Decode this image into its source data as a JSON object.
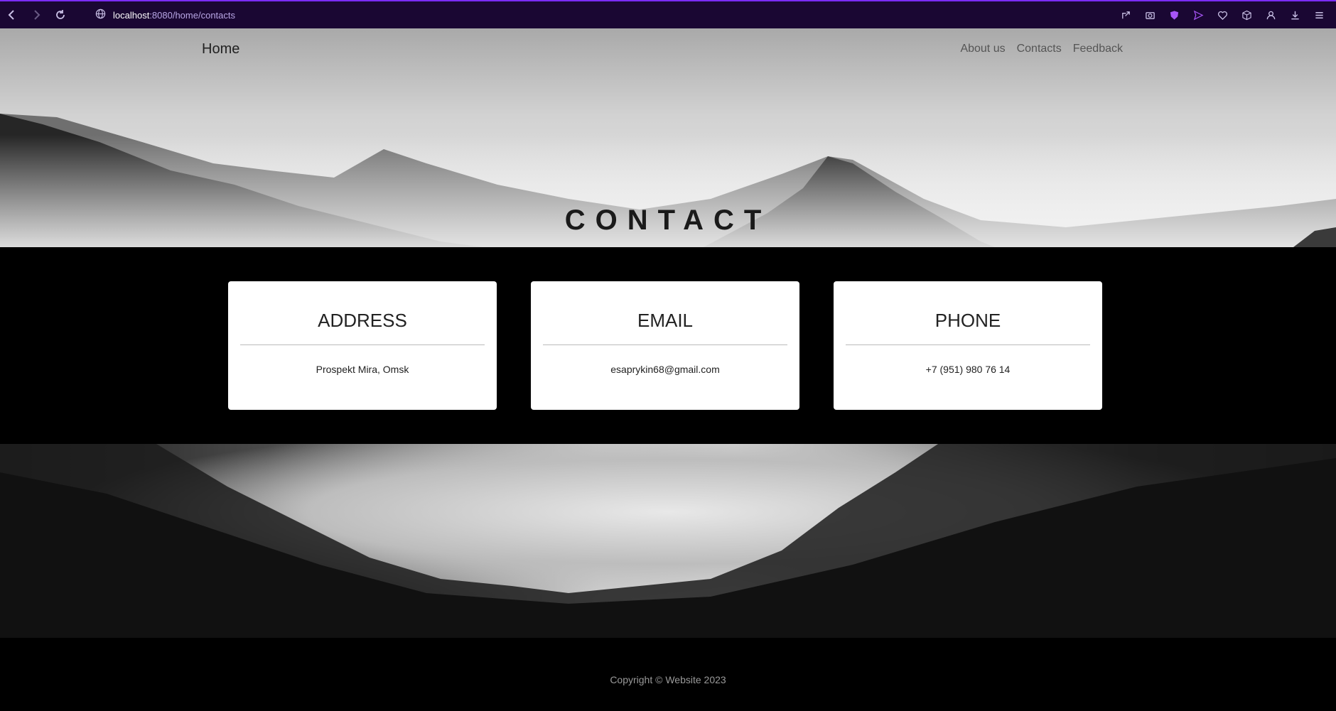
{
  "browser": {
    "url_host": "localhost",
    "url_path": ":8080/home/contacts"
  },
  "nav": {
    "brand": "Home",
    "links": [
      "About us",
      "Contacts",
      "Feedback"
    ]
  },
  "hero": {
    "title": "CONTACT"
  },
  "cards": [
    {
      "title": "ADDRESS",
      "value": "Prospekt Mira, Omsk"
    },
    {
      "title": "EMAIL",
      "value": "esaprykin68@gmail.com"
    },
    {
      "title": "PHONE",
      "value": "+7 (951) 980 76 14"
    }
  ],
  "footer": {
    "copyright": "Copyright © Website 2023"
  }
}
